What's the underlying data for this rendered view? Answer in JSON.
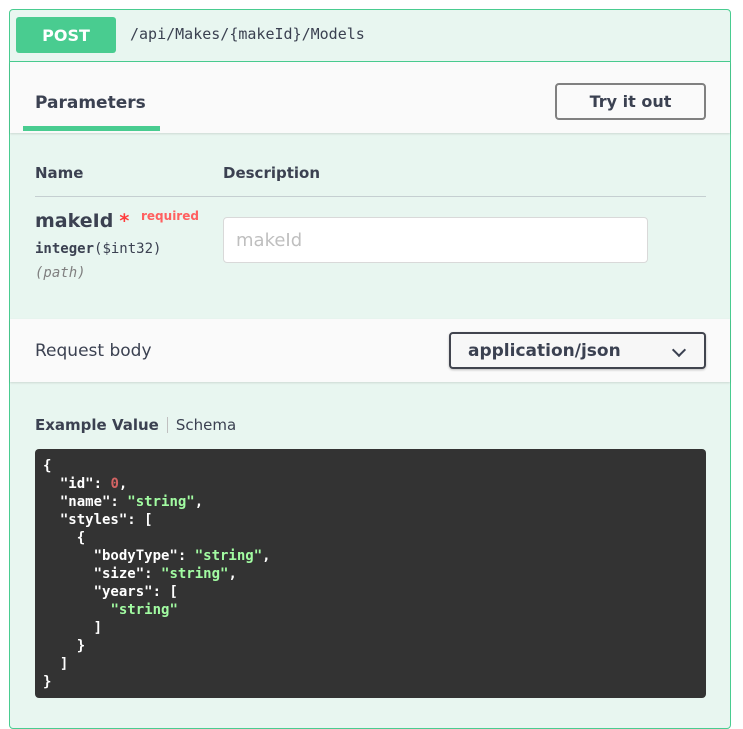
{
  "operation": {
    "method": "POST",
    "path": "/api/Makes/{makeId}/Models",
    "method_color": "#49cc90"
  },
  "parameters": {
    "tab_label": "Parameters",
    "try_it_out_label": "Try it out",
    "columns": {
      "name": "Name",
      "description": "Description"
    },
    "items": [
      {
        "name": "makeId",
        "required_mark": "*",
        "required_label": "required",
        "type": "integer",
        "format": "($int32)",
        "in": "(path)",
        "placeholder": "makeId",
        "value": ""
      }
    ]
  },
  "request_body": {
    "title": "Request body",
    "content_type": "application/json"
  },
  "example": {
    "tab_example": "Example Value",
    "tab_schema": "Schema",
    "json_lines": [
      [
        "{"
      ],
      [
        "  \"id\": ",
        {
          "num": "0"
        },
        ","
      ],
      [
        "  \"name\": ",
        {
          "str": "\"string\""
        },
        ","
      ],
      [
        "  \"styles\": ["
      ],
      [
        "    {"
      ],
      [
        "      \"bodyType\": ",
        {
          "str": "\"string\""
        },
        ","
      ],
      [
        "      \"size\": ",
        {
          "str": "\"string\""
        },
        ","
      ],
      [
        "      \"years\": ["
      ],
      [
        "        ",
        {
          "str": "\"string\""
        }
      ],
      [
        "      ]"
      ],
      [
        "    }"
      ],
      [
        "  ]"
      ],
      [
        "}"
      ]
    ]
  }
}
